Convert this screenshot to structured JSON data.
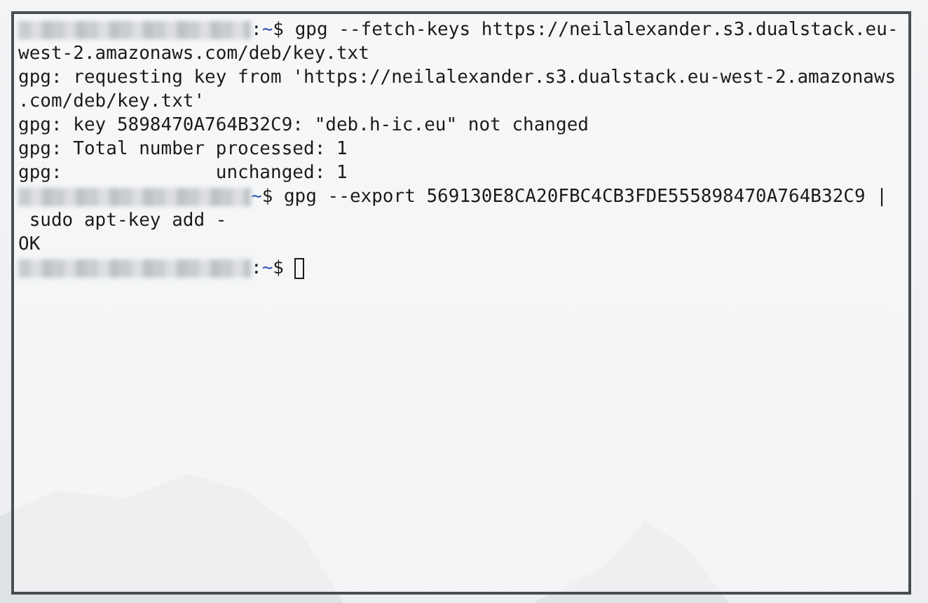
{
  "terminal": {
    "lines": [
      {
        "kind": "prompt",
        "separator": ":",
        "path": "~",
        "symbol": "$",
        "command": "gpg --fetch-keys https://neilalexander.s3.dualstack.eu-"
      },
      {
        "kind": "output",
        "text": "west-2.amazonaws.com/deb/key.txt"
      },
      {
        "kind": "output",
        "text": "gpg: requesting key from 'https://neilalexander.s3.dualstack.eu-west-2.amazonaws"
      },
      {
        "kind": "output",
        "text": ".com/deb/key.txt'"
      },
      {
        "kind": "output",
        "text": "gpg: key 5898470A764B32C9: \"deb.h-ic.eu\" not changed"
      },
      {
        "kind": "output",
        "text": "gpg: Total number processed: 1"
      },
      {
        "kind": "output",
        "text": "gpg:              unchanged: 1"
      },
      {
        "kind": "prompt",
        "path": "~",
        "symbol": "$",
        "command": "gpg --export 569130E8CA20FBC4CB3FDE555898470A764B32C9 |"
      },
      {
        "kind": "output",
        "text": " sudo apt-key add -"
      },
      {
        "kind": "output",
        "text": "OK"
      },
      {
        "kind": "prompt",
        "separator": ":",
        "path": "~",
        "symbol": "$",
        "cursor": true
      }
    ]
  }
}
